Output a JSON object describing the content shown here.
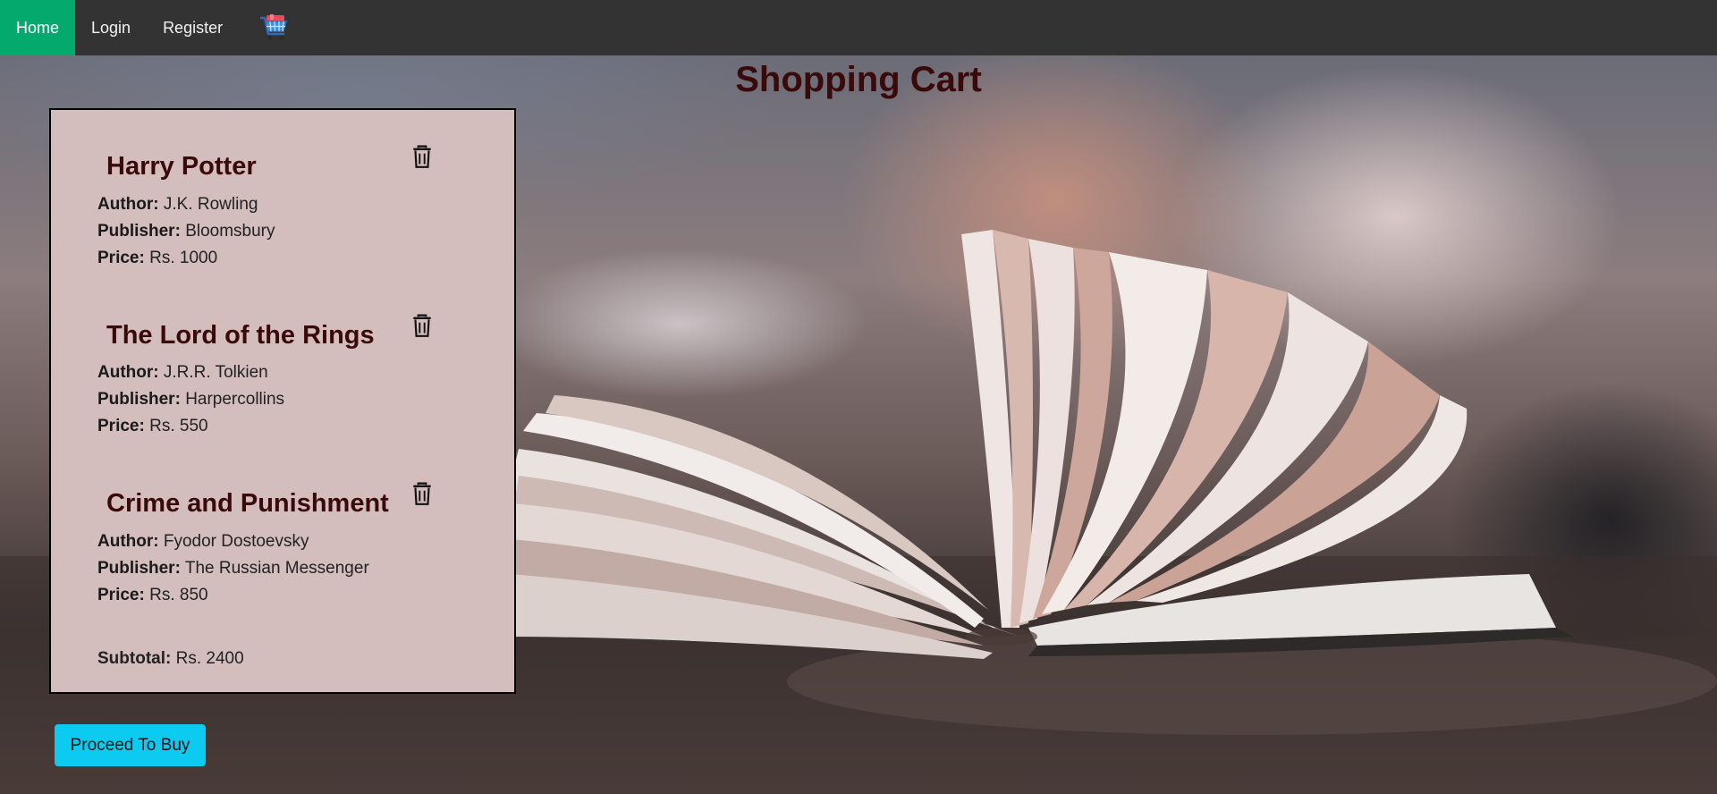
{
  "nav": {
    "items": [
      {
        "label": "Home",
        "active": true
      },
      {
        "label": "Login",
        "active": false
      },
      {
        "label": "Register",
        "active": false
      }
    ],
    "cart_icon": "shopping-cart-icon",
    "active_color": "#04aa6d",
    "bg_color": "#333333"
  },
  "page": {
    "title": "Shopping Cart",
    "background_image": "open-book-on-table"
  },
  "cart": {
    "items": [
      {
        "title": "Harry Potter",
        "author_label": "Author:",
        "author": "J.K. Rowling",
        "publisher_label": "Publisher:",
        "publisher": "Bloomsbury",
        "price_label": "Price:",
        "price": "Rs. 1000"
      },
      {
        "title": "The Lord of the Rings",
        "author_label": "Author:",
        "author": "J.R.R. Tolkien",
        "publisher_label": "Publisher:",
        "publisher": "Harpercollins",
        "price_label": "Price:",
        "price": "Rs. 550"
      },
      {
        "title": "Crime and Punishment",
        "author_label": "Author:",
        "author": "Fyodor Dostoevsky",
        "publisher_label": "Publisher:",
        "publisher": "The Russian Messenger",
        "price_label": "Price:",
        "price": "Rs. 850"
      }
    ],
    "delete_icon": "trash-icon",
    "subtotal_label": "Subtotal:",
    "subtotal": "Rs. 2400",
    "panel_color": "#d3bdbd"
  },
  "actions": {
    "proceed_label": "Proceed To Buy",
    "proceed_color": "#0dcaf0"
  }
}
